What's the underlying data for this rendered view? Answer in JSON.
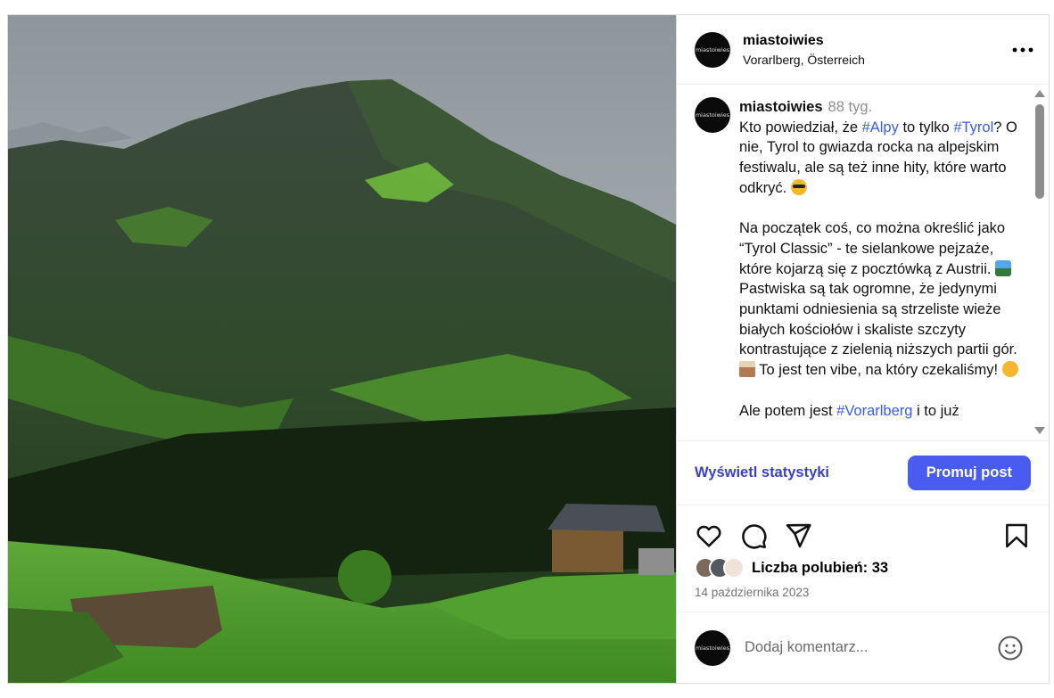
{
  "post": {
    "username": "miastoiwies",
    "avatar_text": "miastoiwies",
    "location": "Vorarlberg, Österreich",
    "more_icon": "more-horizontal-icon"
  },
  "caption": {
    "username": "miastoiwies",
    "age": "88 tyg.",
    "p1_a": "Kto powiedział, że ",
    "p1_tag1": "#Alpy",
    "p1_b": " to tylko ",
    "p1_tag2": "#Tyrol",
    "p1_c": "? O nie, Tyrol to gwiazda rocka na alpejskim festiwalu, ale są też inne hity, które warto odkryć.",
    "p2_a": "Na początek coś, co można określić jako “Tyrol Classic” - te sielankowe pejzaże, które kojarzą się z pocztówką z Austrii.",
    "p2_b": " Pastwiska są tak ogromne, że jedynymi punktami odniesienia są strzeliste wieże białych kościołów i skaliste szczyty kontrastujące z zielenią niższych partii gór.",
    "p2_c": " To jest ten vibe, na który czekaliśmy!",
    "p3_a": "Ale potem jest ",
    "p3_tag": "#Vorarlberg",
    "p3_b": " i to już"
  },
  "stats": {
    "view_stats": "Wyświetl statystyki",
    "promote": "Promuj post"
  },
  "likes": {
    "label": "Liczba polubień: 33"
  },
  "date": "14 października 2023",
  "comment": {
    "placeholder": "Dodaj komentarz..."
  },
  "colors": {
    "accent_link": "#3b3ec7",
    "promote_button": "#4a5cf0",
    "hashtag": "#3a5ddd"
  }
}
